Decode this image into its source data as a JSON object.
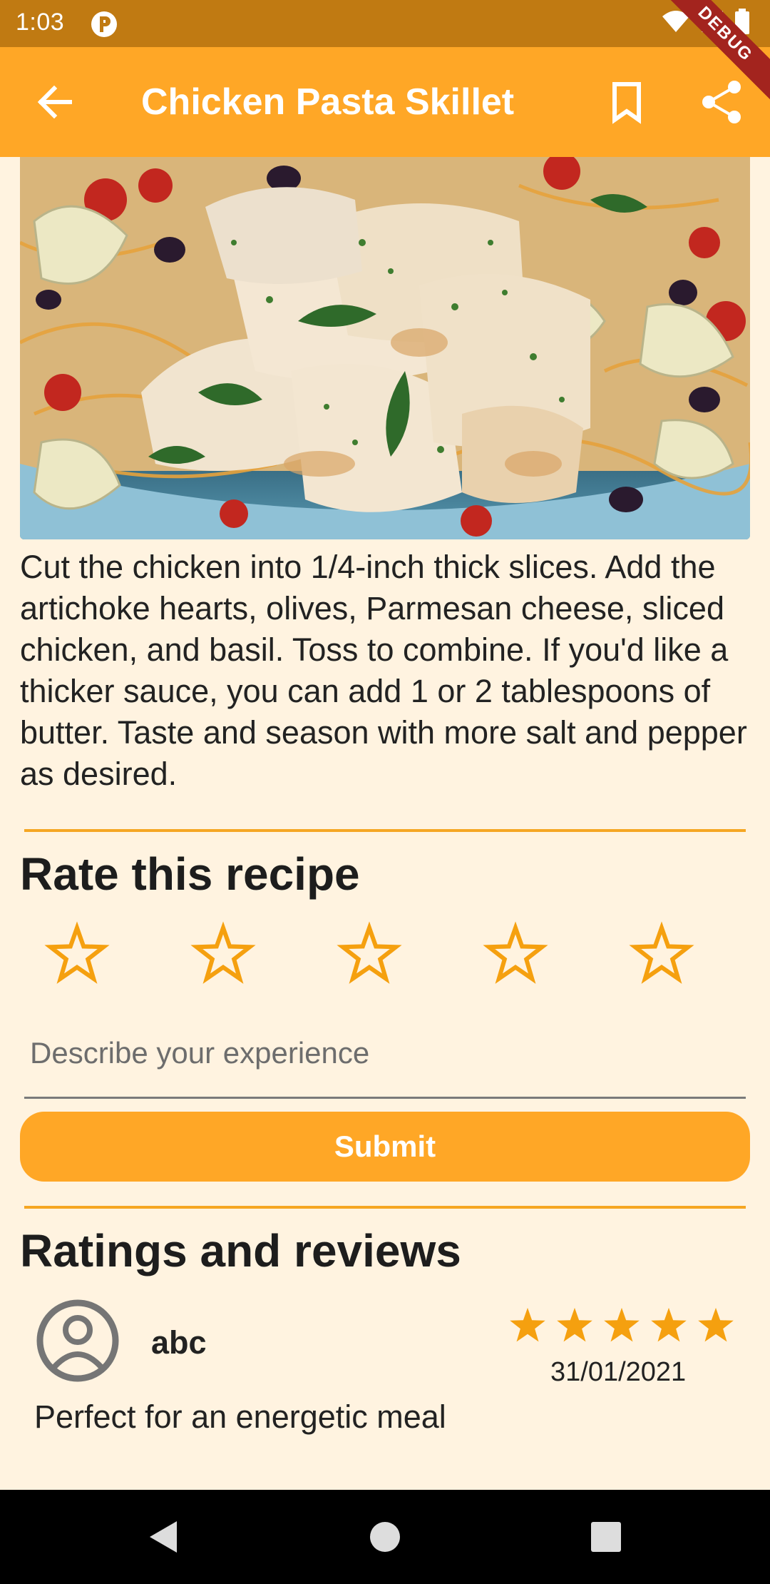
{
  "status_bar": {
    "time": "1:03",
    "debug_label": "DEBUG"
  },
  "app_bar": {
    "title": "Chicken Pasta Skillet",
    "back_icon": "arrow-left-icon",
    "bookmark_icon": "bookmark-outline-icon",
    "share_icon": "share-icon"
  },
  "recipe": {
    "instructions": "Cut the chicken into 1/4-inch thick slices. Add the artichoke hearts, olives, Parmesan cheese, sliced chicken, and basil. Toss to combine. If you'd like a thicker sauce, you can add 1 or 2 tablespoons of butter. Taste and season with more salt and pepper as desired."
  },
  "rate": {
    "title": "Rate this recipe",
    "stars_selected": 0,
    "stars_total": 5,
    "input_placeholder": "Describe your experience",
    "submit_label": "Submit"
  },
  "reviews": {
    "title": "Ratings and reviews",
    "items": [
      {
        "user": "abc",
        "rating": 5,
        "date": "31/01/2021",
        "text": "Perfect for an energetic meal"
      }
    ]
  },
  "colors": {
    "accent": "#FFA726",
    "status_bar": "#C07A12",
    "background": "#FFF3E0",
    "star": "#F5A00F"
  }
}
